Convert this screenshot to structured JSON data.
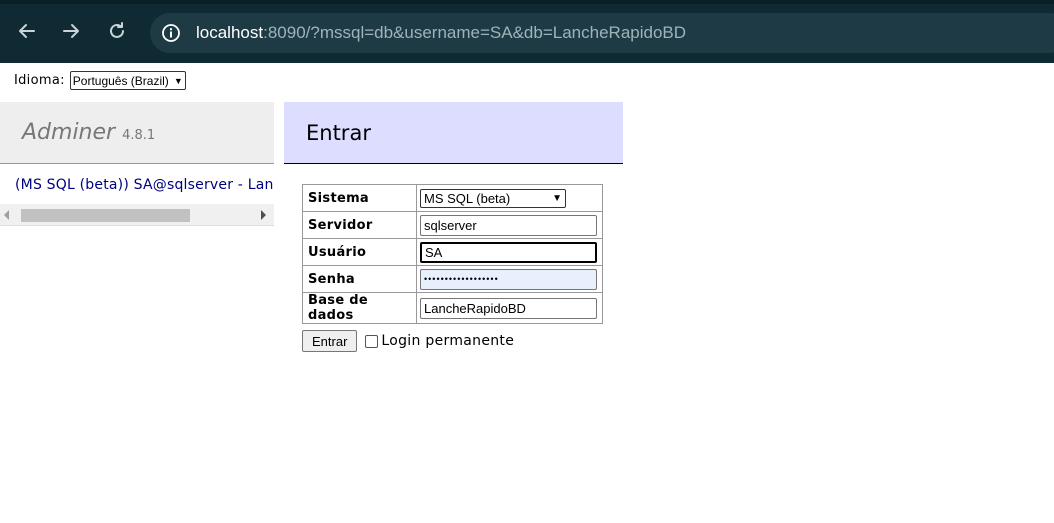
{
  "browser": {
    "url_host": "localhost",
    "url_rest": ":8090/?mssql=db&username=SA&db=LancheRapidoBD",
    "icons": [
      "back-arrow-icon",
      "forward-arrow-icon",
      "reload-icon",
      "info-icon"
    ],
    "colors": {
      "toolbar": "#0f2a33",
      "address_bar": "#1e3a44"
    }
  },
  "language": {
    "label": "Idioma:",
    "selected": "Português (Brazil)"
  },
  "menu": {
    "brand": "Adminer",
    "version": "4.8.1",
    "db_link": "(MS SQL (beta)) SA@sqlserver - LancheRapidoBD"
  },
  "login": {
    "title": "Entrar",
    "fields": {
      "system_label": "Sistema",
      "system_value": "MS SQL (beta)",
      "server_label": "Servidor",
      "server_value": "sqlserver",
      "user_label": "Usuário",
      "user_value": "SA",
      "password_label": "Senha",
      "password_value": "••••••••••••••••••",
      "database_label": "Base de dados",
      "database_value": "LancheRapidoBD"
    },
    "submit_label": "Entrar",
    "permanent_label": "Login permanente",
    "permanent_checked": false
  },
  "colors": {
    "menu_bg": "#eeeeee",
    "header_bg": "#ddddff",
    "link": "#000080"
  }
}
